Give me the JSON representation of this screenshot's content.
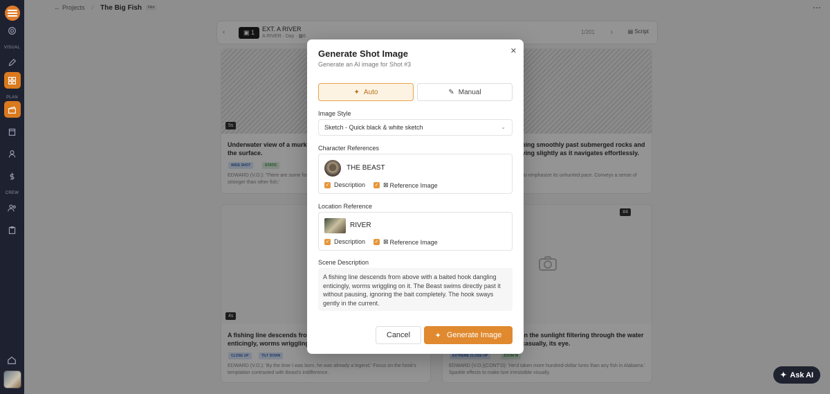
{
  "topbar": {
    "back_label": "Projects",
    "crumb_sep": "/",
    "project_title": "The Big Fish",
    "project_badge": "Film",
    "menu": "⋯"
  },
  "sidebar": {
    "section_visual": "VISUAL",
    "section_plan": "PLAN",
    "section_crew": "CREW"
  },
  "scene": {
    "number": "1",
    "title": "EXT. A RIVER",
    "location": "A RIVER",
    "time": "Day",
    "shot_count": "6",
    "counter": "1/201",
    "script_label": "Script"
  },
  "cards": [
    {
      "duration": "5s",
      "title": "Underwater view of a murky river with sunlight piercing through the surface.",
      "tags": [
        "WIDE SHOT",
        "STATIC"
      ],
      "vo": "EDWARD (V.O.): 'There are some fish that cannot be caught. It's not that they're faster or stronger than other fish.'"
    },
    {
      "title": "The Beast gliding, swimming smoothly past submerged rocks and river weeds, its body curving slightly as it navigates effortlessly.",
      "vo": "Tracking shot alongside the Beast to emphasize its unhurried pace. Conveys a sense of mystique and otherworldliness."
    },
    {
      "duration": "4s",
      "title": "A fishing line descends from above with a baited hook dangling enticingly, worms wriggling on it.",
      "tags": [
        "CLOSE UP",
        "TILT DOWN"
      ],
      "vo": "EDWARD (V.O.): 'By the time I was born, he was already a legend.' Focus on the hook's temptation contrasted with Beast's indifference."
    },
    {
      "badge": "#4",
      "title": "Scales glinting radiantly in the sunlight filtering through the water as the Beast glides by it casually, its eye.",
      "tags": [
        "EXTREME CLOSE UP",
        "ZOOM IN"
      ],
      "vo": "EDWARD (V.O.)(CONT'D): 'He'd taken more hundred-dollar lures than any fish in Alabama.' Sparkle effects to make lure irresistible visually."
    }
  ],
  "modal": {
    "title": "Generate Shot Image",
    "subtitle": "Generate an AI image for Shot #3",
    "close": "✕",
    "mode_auto": "Auto",
    "mode_manual": "Manual",
    "style_label": "Image Style",
    "style_value": "Sketch - Quick black & white sketch",
    "char_label": "Character References",
    "char_name": "THE BEAST",
    "loc_label": "Location Reference",
    "loc_name": "RIVER",
    "desc_check": "Description",
    "ref_check": "Reference Image",
    "scene_label": "Scene Description",
    "scene_text": "A fishing line descends from above with a baited hook dangling enticingly, worms wriggling on it. The Beast swims directly past it without pausing, ignoring the bait completely. The hook sways gently in the current.",
    "cancel": "Cancel",
    "generate": "Generate Image"
  },
  "ask_ai": "Ask AI"
}
